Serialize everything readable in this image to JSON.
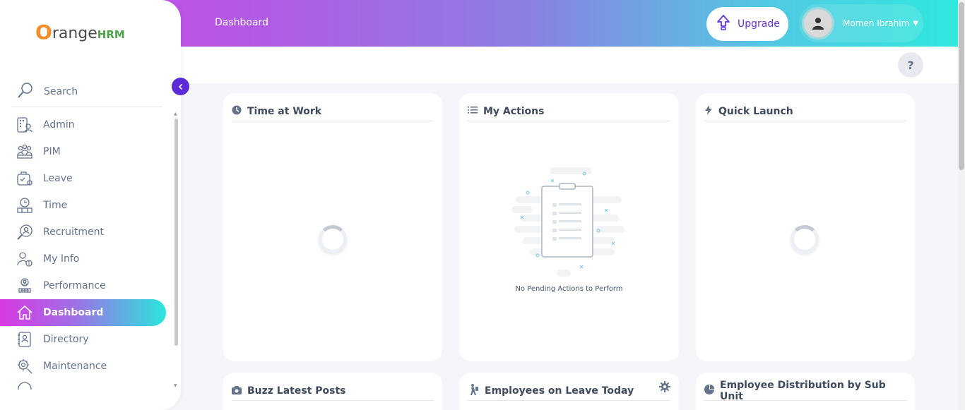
{
  "header": {
    "title": "Dashboard",
    "upgrade_label": "Upgrade",
    "user_name": "Momen Ibrahim",
    "help_label": "?"
  },
  "sidebar": {
    "brand_o": "O",
    "brand_range": "range",
    "brand_hrm": "HRM",
    "search_label": "Search",
    "collapse_icon": "chevron-left-icon",
    "items": [
      {
        "label": "Admin",
        "icon": "admin-icon"
      },
      {
        "label": "PIM",
        "icon": "pim-icon"
      },
      {
        "label": "Leave",
        "icon": "leave-icon"
      },
      {
        "label": "Time",
        "icon": "time-icon"
      },
      {
        "label": "Recruitment",
        "icon": "recruitment-icon"
      },
      {
        "label": "My Info",
        "icon": "my-info-icon"
      },
      {
        "label": "Performance",
        "icon": "performance-icon"
      },
      {
        "label": "Dashboard",
        "icon": "home-icon",
        "active": true
      },
      {
        "label": "Directory",
        "icon": "directory-icon"
      },
      {
        "label": "Maintenance",
        "icon": "maintenance-icon"
      }
    ]
  },
  "cards": {
    "time_at_work": {
      "title": "Time at Work",
      "icon": "clock-icon"
    },
    "my_actions": {
      "title": "My Actions",
      "icon": "list-icon",
      "empty_text": "No Pending Actions to Perform"
    },
    "quick_launch": {
      "title": "Quick Launch",
      "icon": "bolt-icon"
    },
    "buzz": {
      "title": "Buzz Latest Posts",
      "icon": "camera-icon"
    },
    "leave_today": {
      "title": "Employees on Leave Today",
      "icon": "person-walking-icon",
      "settings_icon": "gear-icon"
    },
    "distribution": {
      "title": "Employee Distribution by Sub Unit",
      "icon": "pie-chart-icon"
    }
  },
  "colors": {
    "accent": "#5c2bd8",
    "upgrade_text": "#6533d7",
    "gradient_start": "#d548e9",
    "gradient_end": "#2fe8de"
  }
}
